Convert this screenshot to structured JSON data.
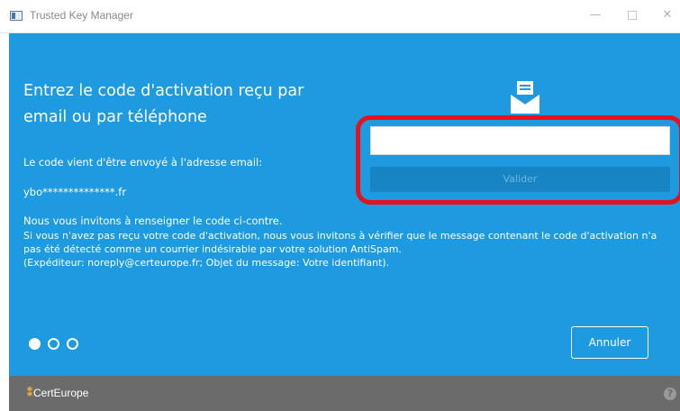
{
  "window": {
    "title": "Trusted Key Manager",
    "controls": {
      "minimize": "—",
      "close": "✕"
    }
  },
  "activation": {
    "heading": "Entrez le code d'activation reçu par email ou par téléphone",
    "sent_notice": "Le code vient d'être envoyé à l'adresse email:",
    "masked_email": "ybo**************.fr",
    "invite": "Nous vous invitons à renseigner le code ci-contre.",
    "spam_notice": "Si vous n'avez pas reçu votre code d'activation, nous vous invitons à vérifier que le message contenant le code d'activation n'a pas été détecté comme un courrier indésirable par votre solution AntiSpam.",
    "sender_info": "(Expéditeur: noreply@certeurope.fr; Objet du message: Votre identifiant).",
    "code_input_value": "",
    "validate_label": "Valider",
    "cancel_label": "Annuler",
    "steps": {
      "total": 3,
      "current": 1
    },
    "icon": "envelope-icon"
  },
  "footer": {
    "logo_mark": "⁑",
    "logo_text": "CertEurope",
    "help_icon": "?"
  },
  "colors": {
    "panel": "#1e9ae0",
    "footer": "#6b6b6b",
    "highlight": "#e8101a",
    "validate_button": "#1785c3"
  }
}
